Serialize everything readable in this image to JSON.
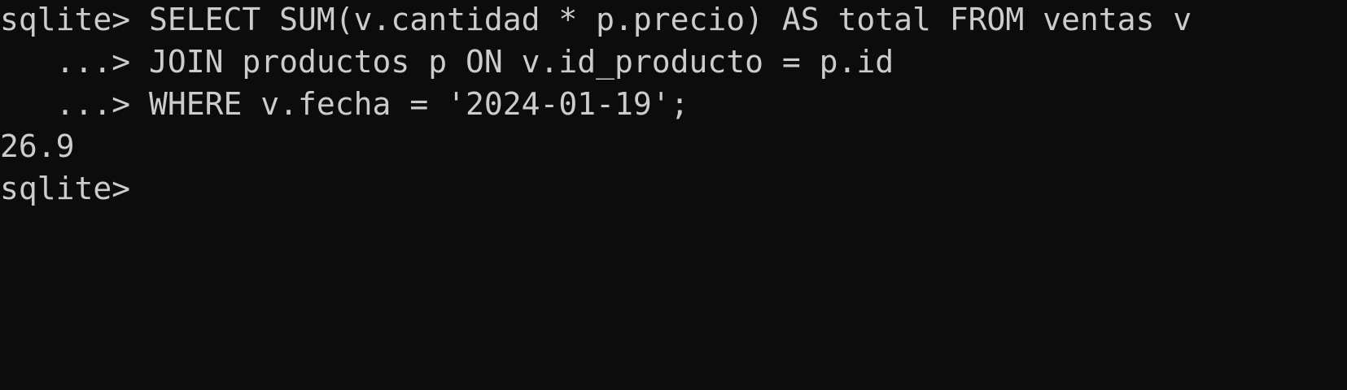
{
  "terminal": {
    "lines": [
      "sqlite> SELECT SUM(v.cantidad * p.precio) AS total FROM ventas v",
      "   ...> JOIN productos p ON v.id_producto = p.id",
      "   ...> WHERE v.fecha = '2024-01-19';",
      "26.9",
      "sqlite> "
    ]
  }
}
